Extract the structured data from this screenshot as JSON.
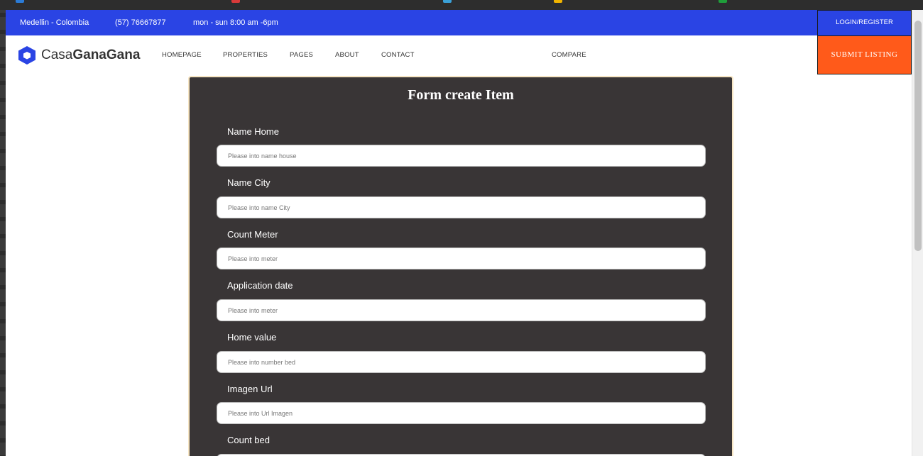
{
  "topbar": {
    "location": "Medellin - Colombia",
    "phone": "(57) 76667877",
    "hours": "mon - sun 8:00 am -6pm",
    "login_label": "LOGIN/REGISTER"
  },
  "brand": {
    "prefix": "Casa",
    "bold": "GanaGana",
    "color": "#2a44e4"
  },
  "nav": {
    "items": [
      {
        "label": "HOMEPAGE"
      },
      {
        "label": "PROPERTIES"
      },
      {
        "label": "PAGES"
      },
      {
        "label": "ABOUT"
      },
      {
        "label": "CONTACT"
      }
    ],
    "compare_label": "COMPARE",
    "submit_label": "SUBMIT LISTING"
  },
  "form": {
    "title": "Form create Item",
    "fields": [
      {
        "label": "Name Home",
        "placeholder": "Please into name house",
        "value": ""
      },
      {
        "label": "Name City",
        "placeholder": "Please into name City",
        "value": ""
      },
      {
        "label": "Count Meter",
        "placeholder": "Please into meter",
        "value": ""
      },
      {
        "label": "Application date",
        "placeholder": "Please into meter",
        "value": ""
      },
      {
        "label": "Home value",
        "placeholder": "Please into number bed",
        "value": ""
      },
      {
        "label": "Imagen Url",
        "placeholder": "Please into Url Imagen",
        "value": ""
      },
      {
        "label": "Count bed",
        "placeholder": "",
        "value": ""
      }
    ]
  },
  "colors": {
    "topbar": "#2a44e4",
    "submit": "#ff5a1a",
    "card": "#393536",
    "card_border": "#f7e6c4"
  }
}
